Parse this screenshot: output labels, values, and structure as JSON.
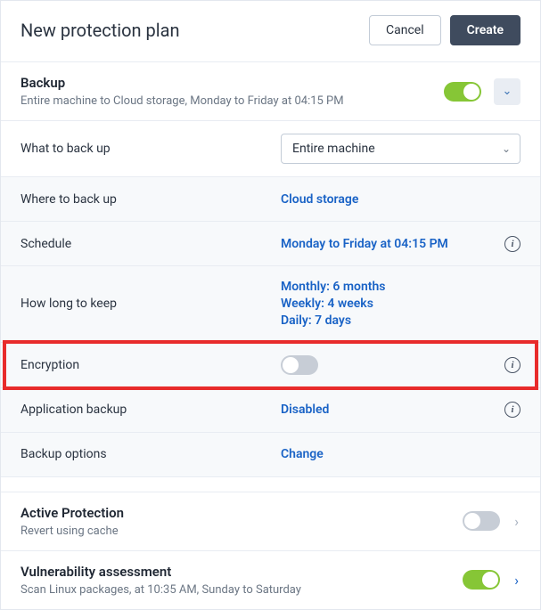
{
  "header": {
    "title": "New protection plan",
    "cancel": "Cancel",
    "create": "Create"
  },
  "backup": {
    "title": "Backup",
    "summary": "Entire machine to Cloud storage, Monday to Friday at 04:15 PM",
    "enabled": true
  },
  "rows": {
    "what_label": "What to back up",
    "what_value": "Entire machine",
    "where_label": "Where to back up",
    "where_value": "Cloud storage",
    "schedule_label": "Schedule",
    "schedule_value": "Monday to Friday at 04:15 PM",
    "keep_label": "How long to keep",
    "keep_line1": "Monthly: 6 months",
    "keep_line2": "Weekly: 4 weeks",
    "keep_line3": "Daily: 7 days",
    "encryption_label": "Encryption",
    "encryption_on": false,
    "appbackup_label": "Application backup",
    "appbackup_value": "Disabled",
    "options_label": "Backup options",
    "options_value": "Change"
  },
  "active_protection": {
    "title": "Active Protection",
    "summary": "Revert using cache",
    "enabled": false
  },
  "vuln": {
    "title": "Vulnerability assessment",
    "summary": "Scan Linux packages, at 10:35 AM, Sunday to Saturday",
    "enabled": true
  },
  "icons": {
    "info": "i"
  }
}
